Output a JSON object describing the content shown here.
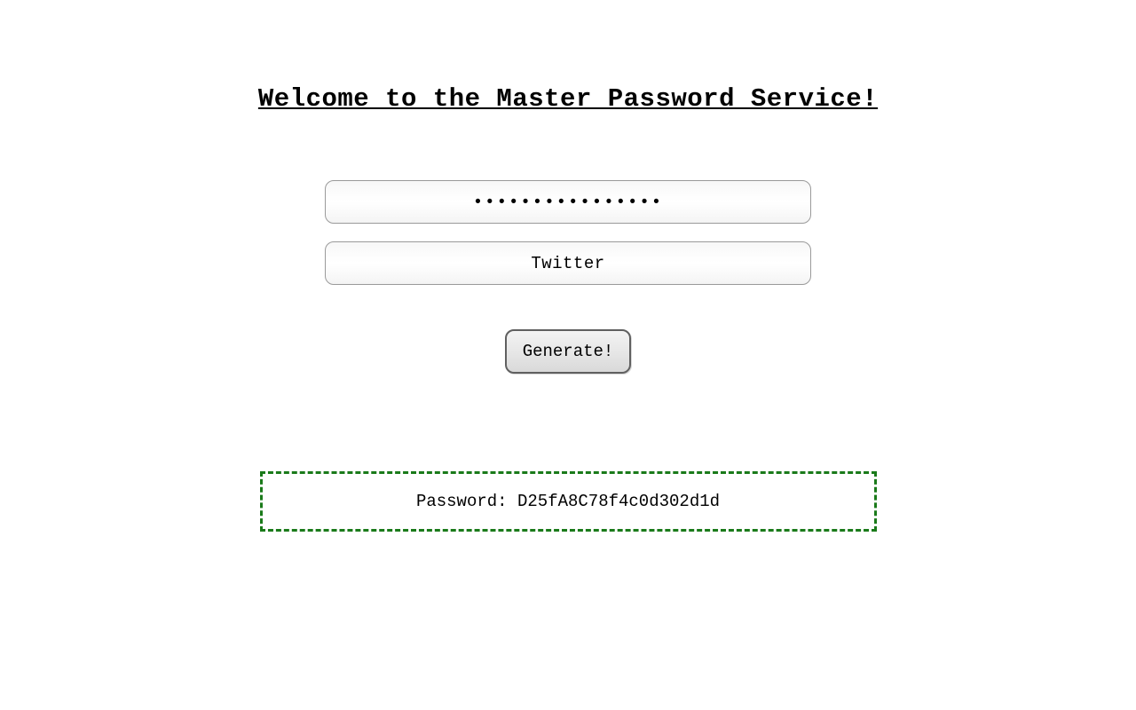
{
  "page": {
    "title": "Welcome to the Master Password Service!"
  },
  "form": {
    "master_password_value": "................",
    "site_value": "Twitter",
    "generate_label": "Generate!"
  },
  "result": {
    "label": "Password: ",
    "value": "D25fA8C78f4c0d302d1d"
  },
  "colors": {
    "result_border": "#1a7a1a"
  }
}
